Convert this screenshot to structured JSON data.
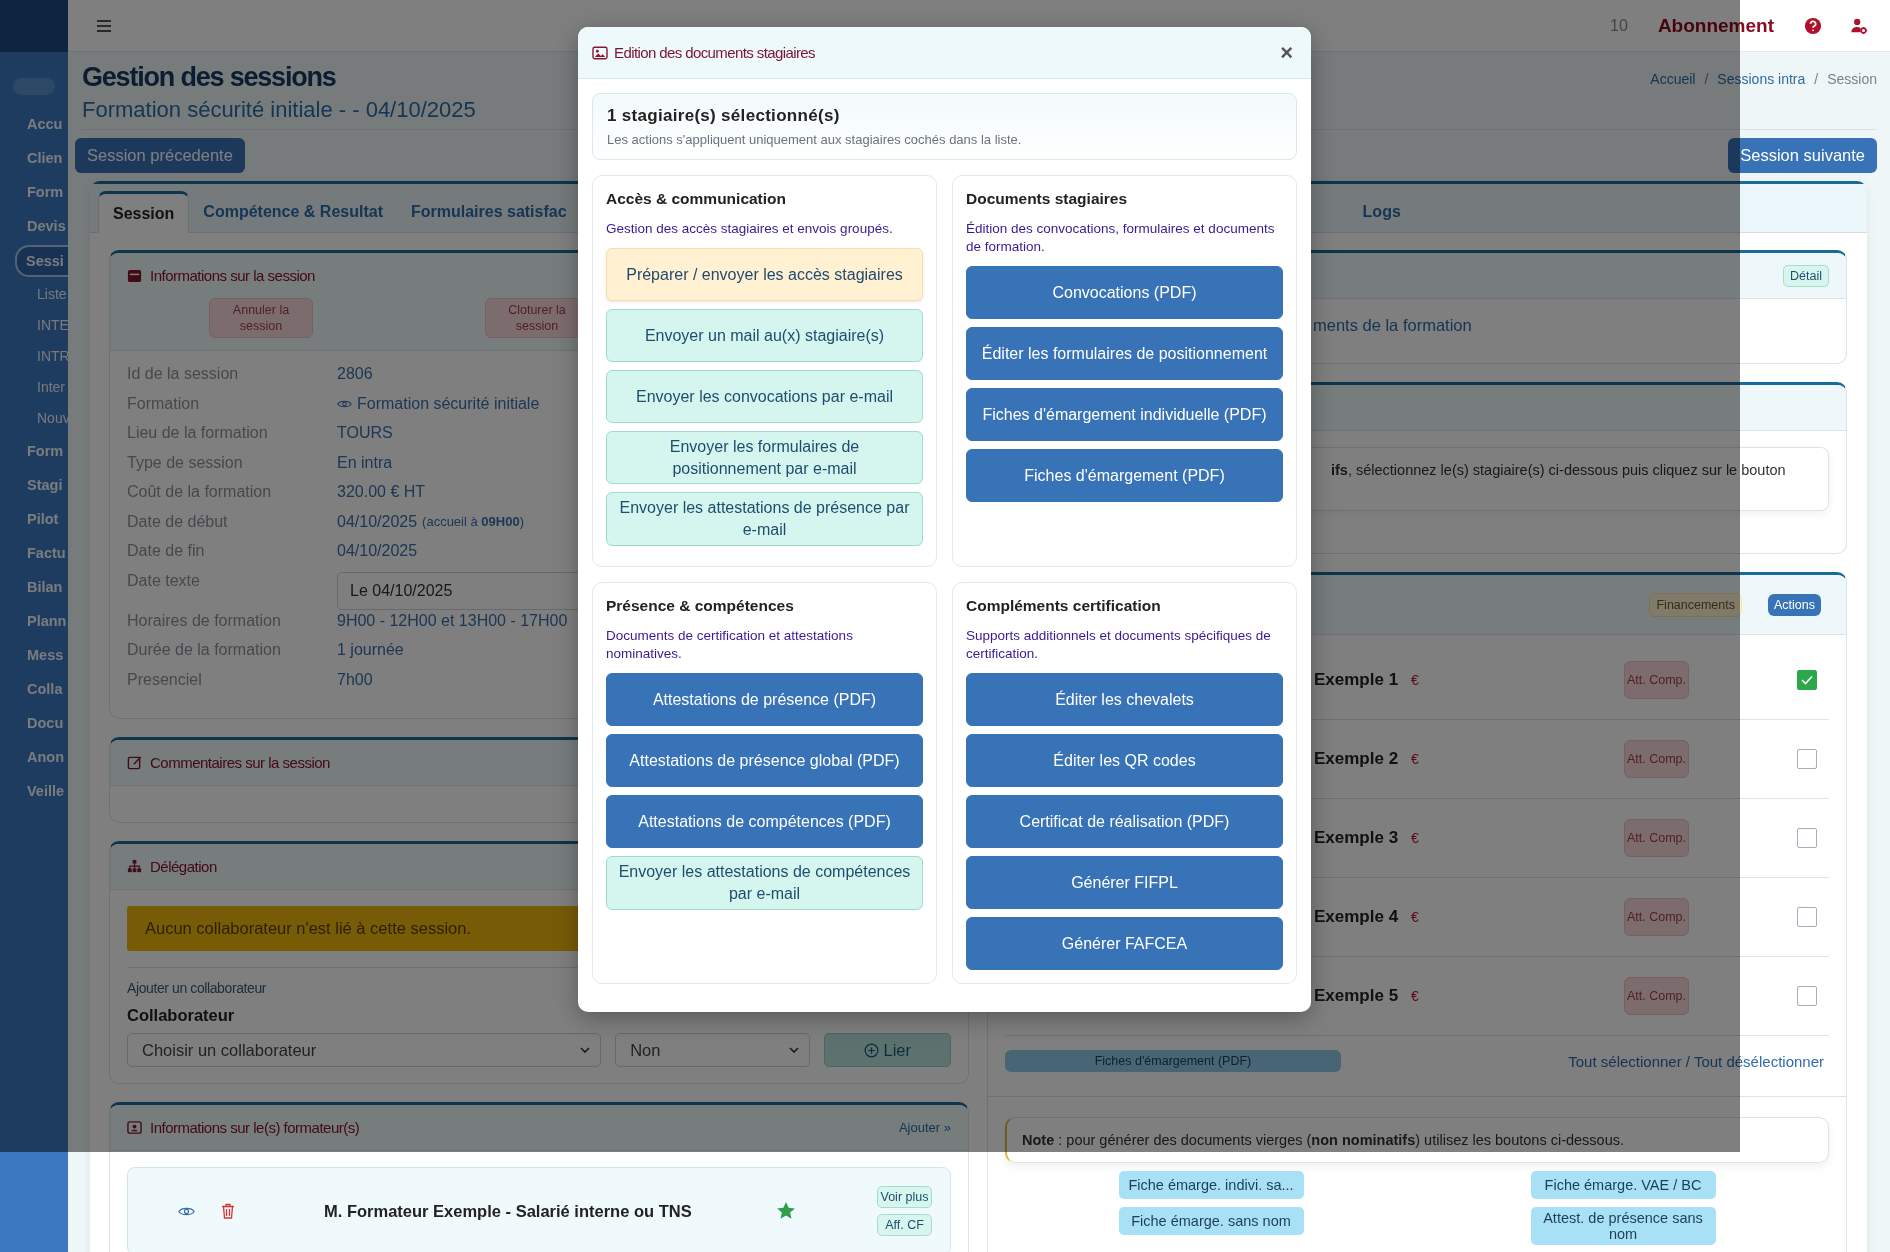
{
  "topbar": {
    "count": "10",
    "subscription": "Abonnement"
  },
  "sidebar": {
    "toggle_on": false,
    "items": [
      {
        "label": "Accu",
        "selected": false
      },
      {
        "label": "Clien",
        "selected": false
      },
      {
        "label": "Form",
        "selected": false
      },
      {
        "label": "Devis",
        "selected": false
      },
      {
        "label": "Sessi",
        "selected": true,
        "children": [
          {
            "label": "Liste"
          },
          {
            "label": "INTE"
          },
          {
            "label": "INTR"
          },
          {
            "label": "Inter"
          },
          {
            "label": "Nouv"
          }
        ]
      },
      {
        "label": "Form",
        "selected": false
      },
      {
        "label": "Stagi",
        "selected": false
      },
      {
        "label": "Pilot",
        "selected": false
      },
      {
        "label": "Factu",
        "selected": false
      },
      {
        "label": "Bilan",
        "selected": false
      },
      {
        "label": "Plann",
        "selected": false
      },
      {
        "label": "Mess",
        "selected": false
      },
      {
        "label": "Colla",
        "selected": false
      },
      {
        "label": "Docu",
        "selected": false
      },
      {
        "label": "Anon",
        "selected": false
      },
      {
        "label": "Veille",
        "selected": false
      }
    ]
  },
  "header": {
    "title": "Gestion des sessions",
    "separator": "/",
    "subtitle": "Formation sécurité initiale - - 04/10/2025",
    "breadcrumb": [
      {
        "label": "Accueil",
        "selected": false
      },
      {
        "label": "Sessions intra",
        "selected": false
      },
      {
        "label": "Session",
        "selected": true
      }
    ]
  },
  "nav": {
    "previous": "Session précedente",
    "next": "Session suivante"
  },
  "tabs": [
    {
      "label": "Session",
      "selected": true
    },
    {
      "label": "Compétence & Resultat",
      "selected": false
    },
    {
      "label": "Formulaires satisfac",
      "selected": false
    },
    {
      "label": "Logs",
      "selected": false
    }
  ],
  "session_info": {
    "title": "Informations sur la session",
    "actions": [
      "Annuler la session",
      "Cloturer la session"
    ],
    "fields": [
      {
        "label": "Id de la session",
        "value": "2806",
        "kind": "text"
      },
      {
        "label": "Formation",
        "value": "Formation sécurité initiale",
        "kind": "link"
      },
      {
        "label": "Lieu de la formation",
        "value": "TOURS",
        "kind": "text"
      },
      {
        "label": "Type de session",
        "value": "En intra",
        "kind": "text"
      },
      {
        "label": "Coût de la formation",
        "value": "320.00 € HT",
        "kind": "text"
      },
      {
        "label": "Date de début",
        "value": "04/10/2025",
        "note": "(accueil à **09H00**)",
        "kind": "text"
      },
      {
        "label": "Date de fin",
        "value": "04/10/2025",
        "kind": "text"
      },
      {
        "label": "Date texte",
        "value": "Le 04/10/2025",
        "kind": "input"
      },
      {
        "label": "Horaires de formation",
        "value": "9H00 - 12H00 et 13H00 - 17H00",
        "kind": "text"
      },
      {
        "label": "Durée de la formation",
        "value": "1 journée",
        "kind": "text"
      },
      {
        "label": "Presenciel",
        "value": "7h00",
        "kind": "text"
      }
    ]
  },
  "comments": {
    "title": "Commentaires sur la session"
  },
  "delegation": {
    "title": "Délégation",
    "alert": "Aucun collaborateur n'est lié à cette session.",
    "subtitle": "Ajouter un collaborateur",
    "label": "Collaborateur",
    "select": "Choisir un collaborateur",
    "select_2": "Non",
    "button": "Lier"
  },
  "trainers": {
    "title": "Informations sur le(s) formateur(s)",
    "add": "Ajouter »",
    "items": [
      {
        "name": "M. Formateur Exemple - Salarié interne ou TNS",
        "starred": true,
        "buttons": [
          "Voir plus",
          "Aff. CF"
        ]
      }
    ]
  },
  "right": {
    "formation_card": {
      "button": "Détail",
      "text": "ments de la formation"
    },
    "forms_card": {
      "note": "**ifs**, sélectionnez le(s) stagiaire(s) ci-dessous puis cliquez sur le bouton"
    },
    "trainees_card": {
      "badges": [
        {
          "label": "Financements",
          "kind": "warning"
        },
        {
          "label": "Actions",
          "kind": "primary"
        }
      ],
      "trainees": [
        {
          "name": "Exemple 1",
          "currency": "€",
          "button": "Att. Comp.",
          "checked": true
        },
        {
          "name": "Exemple 2",
          "currency": "€",
          "button": "Att. Comp.",
          "checked": false
        },
        {
          "name": "Exemple 3",
          "currency": "€",
          "button": "Att. Comp.",
          "checked": false
        },
        {
          "name": "Exemple 4",
          "currency": "€",
          "button": "Att. Comp.",
          "checked": false
        },
        {
          "name": "Exemple 5",
          "currency": "€",
          "button": "Att. Comp.",
          "checked": false
        }
      ],
      "sheet_button": "Fiches d'émargement (PDF)",
      "select_all": "Tout sélectionner / Tout désélectionner",
      "note": "**Note** : pour générer des documents vierges (**non nominatifs**) utilisez les boutons ci-dessous.",
      "blank_buttons": [
        "Fiche émarge. indivi. sa...",
        "Fiche émarge. VAE / BC",
        "Fiche émarge. sans nom",
        "Attest. de présence sans nom"
      ]
    }
  },
  "modal": {
    "title": "Edition des documents stagiaires",
    "close": "×",
    "summary": {
      "title": "1 stagiaire(s) sélectionné(s)",
      "text": "Les actions s'appliquent uniquement aux stagiaires cochés dans la liste."
    },
    "sections": [
      {
        "title": "Accès & communication",
        "description": "Gestion des accès stagiaires et envois groupés.",
        "buttons": [
          {
            "label": "Préparer / envoyer les accès stagiaires",
            "kind": "warning"
          },
          {
            "label": "Envoyer un mail au(x) stagiaire(s)",
            "kind": "light"
          },
          {
            "label": "Envoyer les convocations par e-mail",
            "kind": "light"
          },
          {
            "label": "Envoyer les formulaires de positionnement par e-mail",
            "kind": "light"
          },
          {
            "label": "Envoyer les attestations de présence par e-mail",
            "kind": "light"
          }
        ]
      },
      {
        "title": "Documents stagiaires",
        "description": "Édition des convocations, formulaires et documents de formation.",
        "buttons": [
          {
            "label": "Convocations (PDF)",
            "kind": "primary"
          },
          {
            "label": "Éditer les formulaires de positionnement",
            "kind": "primary"
          },
          {
            "label": "Fiches d'émargement individuelle (PDF)",
            "kind": "primary"
          },
          {
            "label": "Fiches d'émargement (PDF)",
            "kind": "primary"
          }
        ]
      },
      {
        "title": "Présence & compétences",
        "description": "Documents de certification et attestations nominatives.",
        "buttons": [
          {
            "label": "Attestations de présence (PDF)",
            "kind": "primary"
          },
          {
            "label": "Attestations de présence global (PDF)",
            "kind": "primary"
          },
          {
            "label": "Attestations de compétences (PDF)",
            "kind": "primary"
          },
          {
            "label": "Envoyer les attestations de compétences par e-mail",
            "kind": "light"
          }
        ]
      },
      {
        "title": "Compléments certification",
        "description": "Supports additionnels et documents spécifiques de certification.",
        "buttons": [
          {
            "label": "Éditer les chevalets",
            "kind": "primary"
          },
          {
            "label": "Éditer les QR codes",
            "kind": "primary"
          },
          {
            "label": "Certificat de réalisation (PDF)",
            "kind": "primary"
          },
          {
            "label": "Générer FIFPL",
            "kind": "primary"
          },
          {
            "label": "Générer FAFCEA",
            "kind": "primary"
          }
        ]
      }
    ]
  }
}
